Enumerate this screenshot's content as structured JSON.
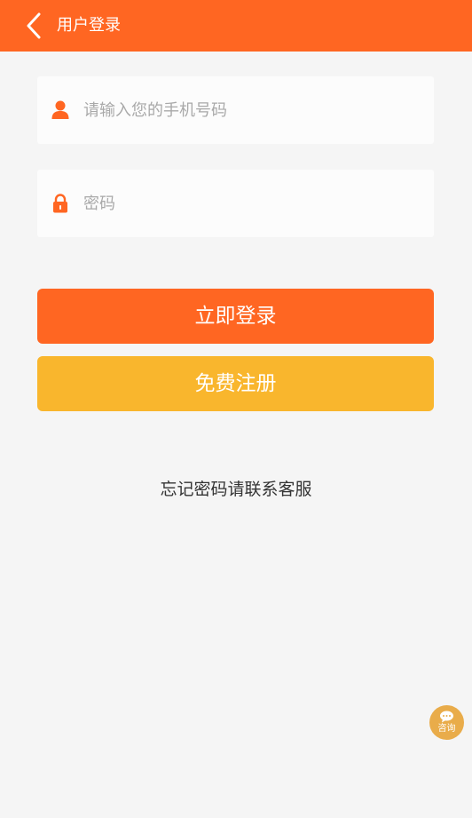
{
  "header": {
    "title": "用户登录"
  },
  "form": {
    "phone_placeholder": "请输入您的手机号码",
    "password_placeholder": "密码",
    "login_label": "立即登录",
    "register_label": "免费注册",
    "forgot_text": "忘记密码请联系客服"
  },
  "consult": {
    "label": "咨询"
  },
  "colors": {
    "brand": "#ff6622",
    "register": "#f9b62d",
    "background": "#f5f5f5",
    "consult": "#e9ac4a"
  },
  "icons": {
    "back": "chevron-left-icon",
    "phone": "user-icon",
    "password": "lock-icon",
    "consult": "chat-bubble-icon"
  }
}
